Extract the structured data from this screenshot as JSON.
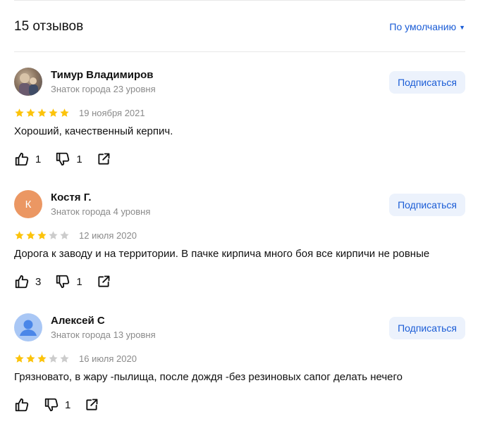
{
  "header": {
    "count": "15 отзывов",
    "sort": "По умолчанию"
  },
  "colors": {
    "accent": "#1a5cd6",
    "star_filled": "#fcc30b",
    "star_empty": "#cccccc"
  },
  "subscribe_label": "Подписаться",
  "reviews": [
    {
      "name": "Тимур Владимиров",
      "level": "Знаток города 23 уровня",
      "avatar": "photo",
      "rating": 5,
      "date": "19 ноября 2021",
      "text": "Хороший, качественный керпич.",
      "likes": "1",
      "dislikes": "1"
    },
    {
      "name": "Костя Г.",
      "level": "Знаток города 4 уровня",
      "avatar": "К",
      "rating": 3,
      "date": "12 июля 2020",
      "text": "Дорога к заводу и на территории. В пачке кирпича много боя все кирпичи не ровные",
      "likes": "3",
      "dislikes": "1"
    },
    {
      "name": "Алексей С",
      "level": "Знаток города 13 уровня",
      "avatar": "person-icon",
      "rating": 3,
      "date": "16 июля 2020",
      "text": "Грязновато, в жару -пылища, после дождя -без резиновых сапог делать нечего",
      "likes": "",
      "dislikes": "1"
    }
  ]
}
